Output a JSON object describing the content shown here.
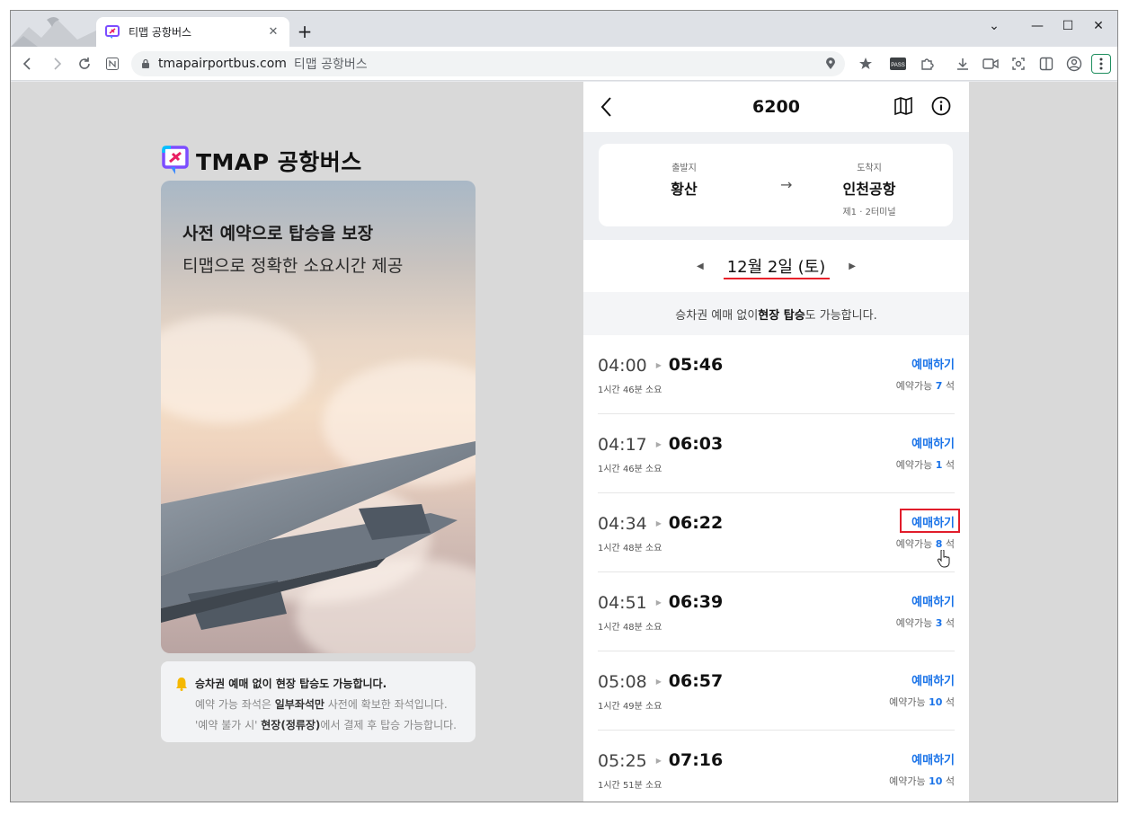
{
  "browser": {
    "tab_title": "티맵 공항버스",
    "tab_close": "✕",
    "new_tab": "+",
    "url": "tmapairportbus.com",
    "page_title": "티맵 공항버스",
    "controls": {
      "dropdown": "⌄",
      "minimize": "—",
      "maximize": "☐",
      "close": "✕"
    }
  },
  "left": {
    "brand": "TMAP 공항버스",
    "hero_title": "사전 예약으로 탑승을 보장",
    "hero_subtitle": "티맵으로 정확한 소요시간 제공",
    "notice_title": "승차권 예매 없이 현장 탑승도 가능합니다.",
    "notice_line1_a": "예약 가능 좌석은 ",
    "notice_line1_b": "일부좌석만",
    "notice_line1_c": " 사전에 확보한 좌석입니다.",
    "notice_line2_a": "'예약 불가 시' ",
    "notice_line2_b": "현장(정류장)",
    "notice_line2_c": "에서 결제 후 탑승 가능합니다."
  },
  "panel": {
    "title": "6200",
    "origin_label": "출발지",
    "origin": "황산",
    "arrow": "→",
    "dest_label": "도착지",
    "dest": "인천공항",
    "dest_sub": "제1 · 2터미널",
    "date": "12월 2일 (토)",
    "prev_date": "◀",
    "next_date": "▶",
    "info_a": "승차권 예매 없이 ",
    "info_b": "현장 탑승",
    "info_c": "도 가능합니다.",
    "book_label": "예매하기",
    "seat_prefix": "예약가능 ",
    "seat_suffix": " 석",
    "departures": [
      {
        "dep": "04:00",
        "arr": "05:46",
        "duration": "1시간 46분 소요",
        "seats": "7"
      },
      {
        "dep": "04:17",
        "arr": "06:03",
        "duration": "1시간 46분 소요",
        "seats": "1"
      },
      {
        "dep": "04:34",
        "arr": "06:22",
        "duration": "1시간 48분 소요",
        "seats": "8"
      },
      {
        "dep": "04:51",
        "arr": "06:39",
        "duration": "1시간 48분 소요",
        "seats": "3"
      },
      {
        "dep": "05:08",
        "arr": "06:57",
        "duration": "1시간 49분 소요",
        "seats": "10"
      },
      {
        "dep": "05:25",
        "arr": "07:16",
        "duration": "1시간 51분 소요",
        "seats": "10"
      }
    ]
  },
  "colors": {
    "accent_blue": "#1a73e8",
    "highlight_red": "#e11d2b",
    "underline_red": "#e8202a"
  }
}
